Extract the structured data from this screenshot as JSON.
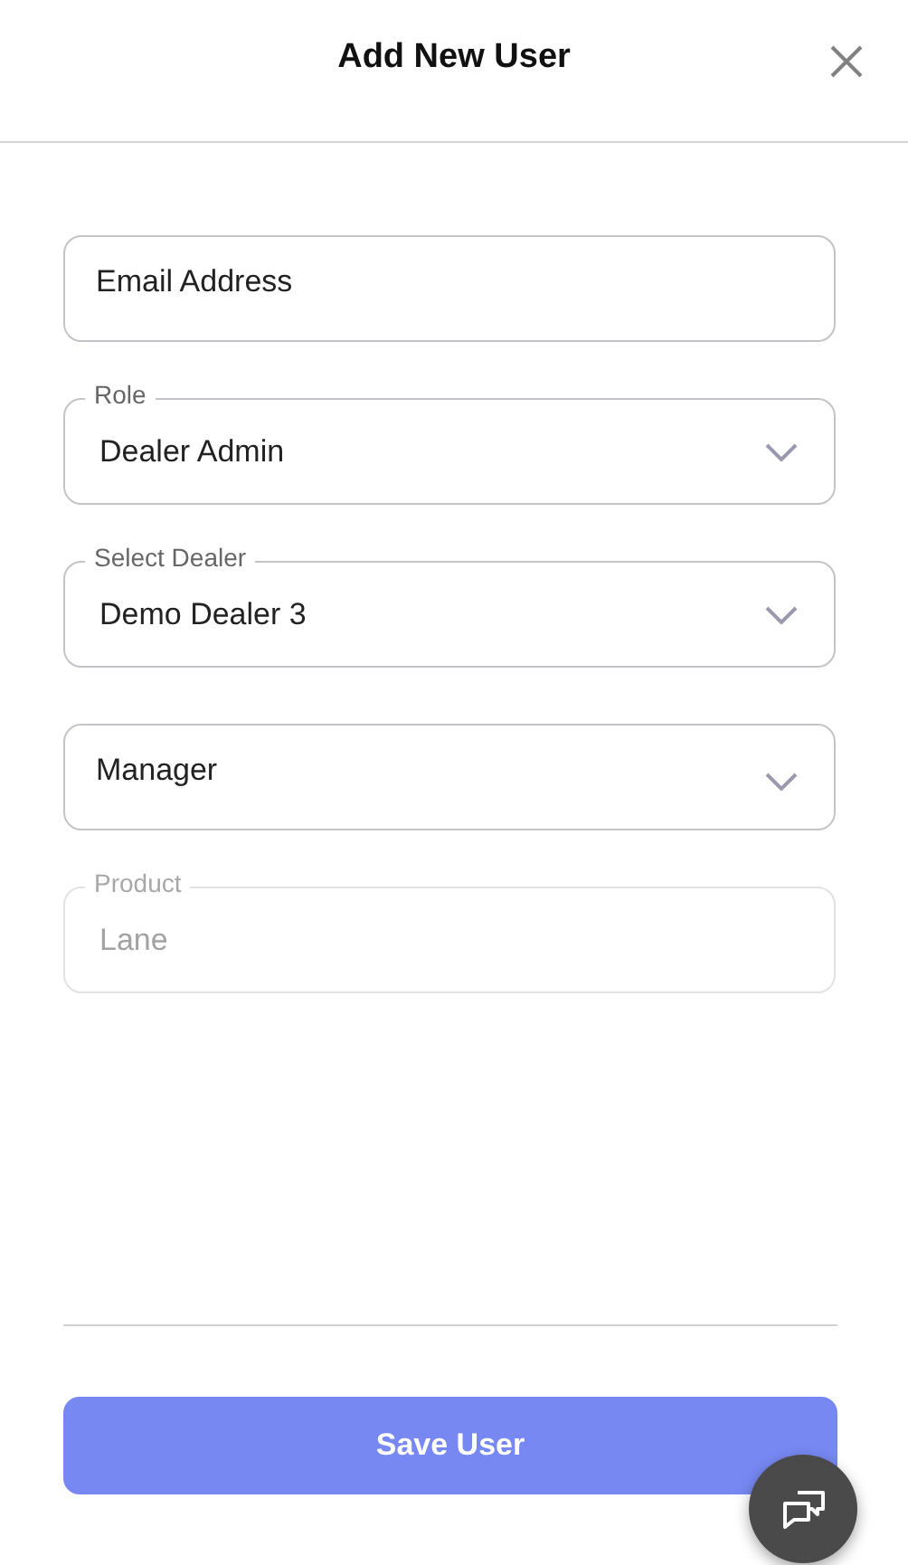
{
  "header": {
    "title": "Add New User"
  },
  "fields": [
    {
      "kind": "text",
      "placeholder": "Email Address",
      "disabled": false
    },
    {
      "kind": "select",
      "label": "Role",
      "value": "Dealer Admin",
      "disabled": false
    },
    {
      "kind": "select",
      "label": "Select Dealer",
      "value": "Demo Dealer 3",
      "disabled": false
    },
    {
      "kind": "select",
      "placeholder": "Manager",
      "disabled": false
    },
    {
      "kind": "text",
      "label": "Product",
      "value": "Lane",
      "disabled": true
    }
  ],
  "save_button": {
    "label": "Save User"
  }
}
